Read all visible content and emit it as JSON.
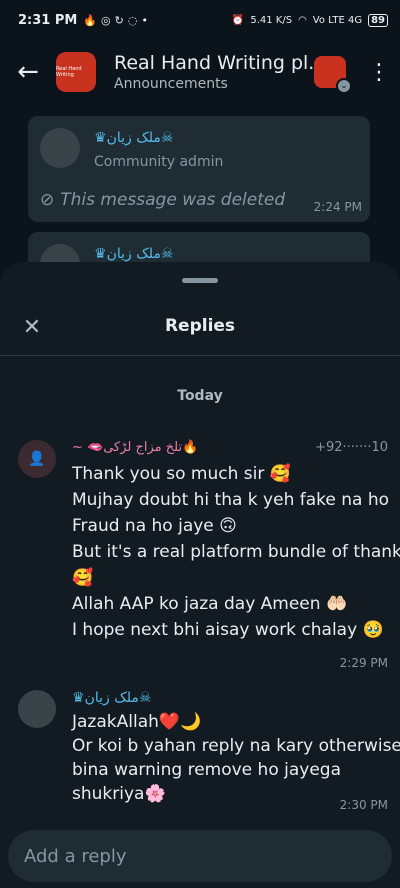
{
  "status_bar": {
    "time": "2:31 PM",
    "icons": [
      "fire-icon",
      "whatsapp-icon",
      "sync-icon",
      "snapchat-icon"
    ],
    "net_speed": "5.41 K/S",
    "network": "Vo LTE 4G",
    "battery": "89"
  },
  "header": {
    "title": "Real Hand Writing pl...",
    "subtitle": "Announcements",
    "logo_text": "Real Hand Writing"
  },
  "background_chat": {
    "msg1": {
      "sender": "♛ملک زیان☠",
      "role": "Community admin",
      "deleted_text": "This message was deleted",
      "time": "2:24 PM"
    },
    "msg2": {
      "sender": "♛ملک زیان☠"
    }
  },
  "sheet": {
    "title": "Replies",
    "day_label": "Today",
    "messages": [
      {
        "sender": "~ 🫦تلخ مزاج لڑکی🔥",
        "phone": "+92·······10",
        "lines": [
          "Thank you so much sir 🥰",
          "Mujhay doubt hi tha k yeh fake na ho",
          "Fraud na ho jaye 🙃",
          "But it's a real platform bundle of thanks",
          "🥰",
          "Allah AAP ko jaza day Ameen 🤲🏻",
          "I hope next bhi aisay work chalay 🥹"
        ],
        "time": "2:29 PM"
      },
      {
        "sender": "♛ملک زیان☠",
        "lines": [
          "JazakAllah❤️🌙",
          "Or koi b yahan reply na kary otherwise",
          "bina warning remove ho jayega",
          "shukriya🌸"
        ],
        "time": "2:30 PM"
      }
    ]
  },
  "reply_input": {
    "placeholder": "Add a reply",
    "value": ""
  }
}
